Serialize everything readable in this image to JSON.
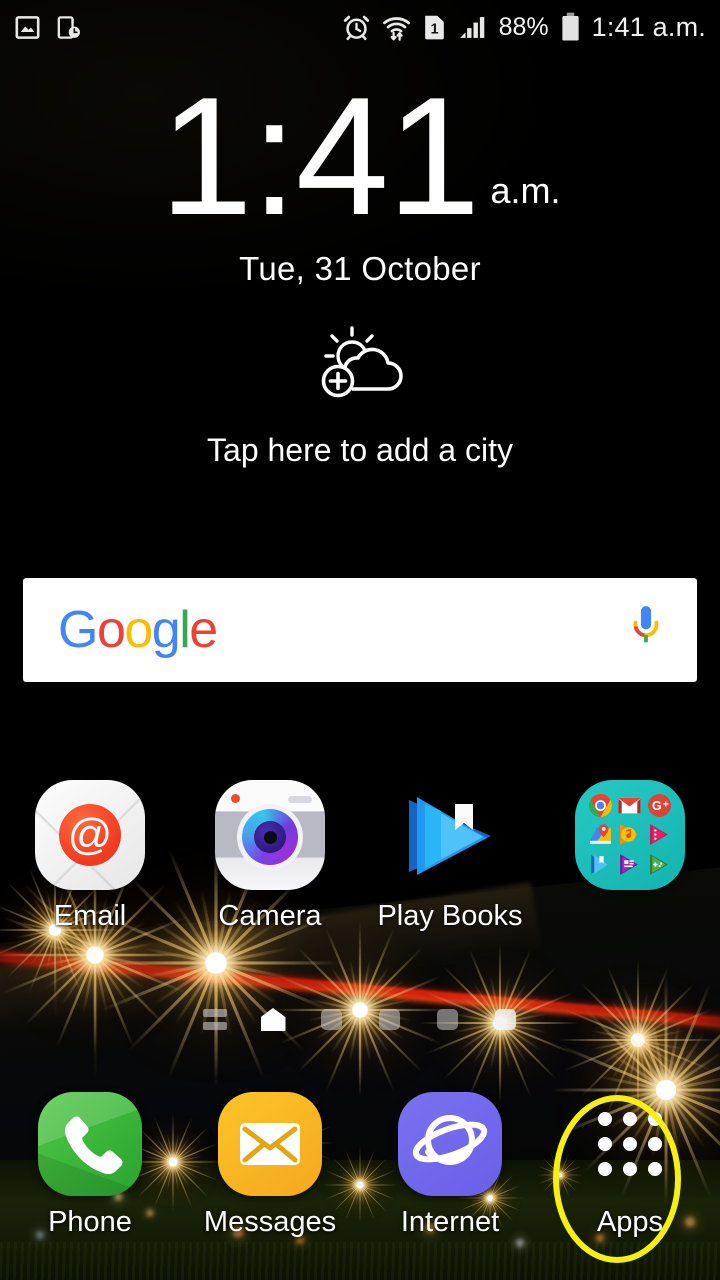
{
  "status_bar": {
    "left_icons": [
      {
        "name": "screenshot-captured-icon",
        "label": "screenshot"
      },
      {
        "name": "screen-timeout-icon",
        "label": "phone-clock"
      }
    ],
    "right_icons": [
      {
        "name": "alarm-icon",
        "label": "alarm"
      },
      {
        "name": "wifi-transfer-icon",
        "label": "wifi"
      },
      {
        "name": "sim-card-icon",
        "label": "SIM 1"
      },
      {
        "name": "signal-bars-icon",
        "label": "signal"
      }
    ],
    "sim_number": "1",
    "battery_percent": "88%",
    "battery_icon": "battery-icon",
    "time": "1:41 a.m."
  },
  "clock_widget": {
    "time": "1:41",
    "ampm": "a.m.",
    "date": "Tue, 31 October"
  },
  "weather_widget": {
    "icon": "sun-cloud-add-icon",
    "text": "Tap here to add a city"
  },
  "search_bar": {
    "logo": "Google",
    "logo_letters": [
      {
        "char": "G",
        "color": "#4285F4"
      },
      {
        "char": "o",
        "color": "#EA4335"
      },
      {
        "char": "o",
        "color": "#FBBC05"
      },
      {
        "char": "g",
        "color": "#4285F4"
      },
      {
        "char": "l",
        "color": "#34A853"
      },
      {
        "char": "e",
        "color": "#EA4335"
      }
    ],
    "mic_icon": "microphone-icon"
  },
  "app_grid": [
    {
      "label": "Email",
      "icon": "email-icon"
    },
    {
      "label": "Camera",
      "icon": "camera-icon"
    },
    {
      "label": "Play Books",
      "icon": "play-books-icon"
    },
    {
      "label": "",
      "icon": "google-folder-icon",
      "folder_apps": [
        "Chrome",
        "Gmail",
        "Google+",
        "Maps",
        "Play Music",
        "Play Movies",
        "Play Books",
        "Play Newsstand",
        "Play Games"
      ]
    }
  ],
  "page_indicators": {
    "items": [
      {
        "type": "feed",
        "active": false
      },
      {
        "type": "home",
        "active": true
      },
      {
        "type": "square",
        "active": false
      },
      {
        "type": "square",
        "active": false
      },
      {
        "type": "square",
        "active": false
      },
      {
        "type": "square",
        "active": false
      }
    ]
  },
  "dock": [
    {
      "label": "Phone",
      "icon": "phone-icon"
    },
    {
      "label": "Messages",
      "icon": "messages-icon"
    },
    {
      "label": "Internet",
      "icon": "internet-icon"
    },
    {
      "label": "Apps",
      "icon": "apps-grid-icon"
    }
  ],
  "annotation": {
    "target": "Apps",
    "shape": "ellipse",
    "color": "#F5EF12"
  },
  "colors": {
    "accent_yellow": "#F5EF12",
    "folder_teal": "#1BBFBF",
    "phone_green": "#3CB83A",
    "messages_amber": "#FBBC05",
    "internet_indigo": "#6A5FE8",
    "email_red": "#EF3A20"
  }
}
